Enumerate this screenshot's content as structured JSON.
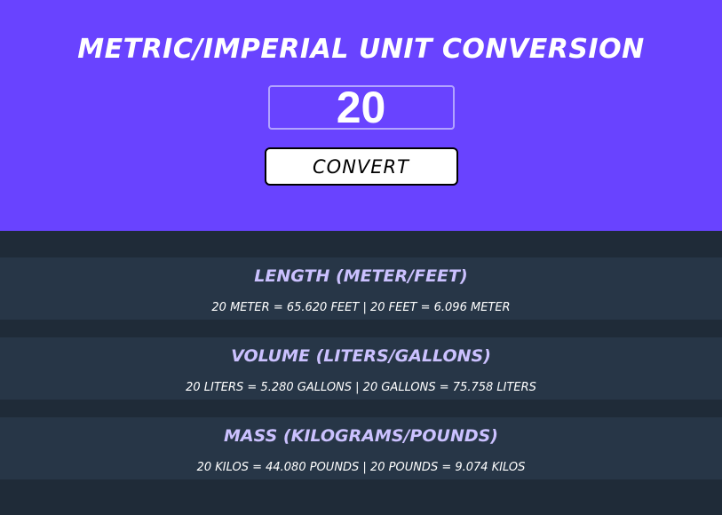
{
  "header": {
    "title": "METRIC/IMPERIAL UNIT CONVERSION"
  },
  "input": {
    "value": "20"
  },
  "convert_button": {
    "label": "CONVERT"
  },
  "conversions": [
    {
      "title": "LENGTH (METER/FEET)",
      "result": "20 METER = 65.620 FEET | 20 FEET = 6.096 METER"
    },
    {
      "title": "VOLUME (LITERS/GALLONS)",
      "result": "20 LITERS = 5.280 GALLONS | 20 GALLONS = 75.758 LITERS"
    },
    {
      "title": "MASS (KILOGRAMS/POUNDS)",
      "result": "20 KILOS = 44.080 POUNDS | 20 POUNDS = 9.074 KILOS"
    }
  ],
  "colors": {
    "hero_background": "#6943ff",
    "page_background": "#1f2b38",
    "card_background": "#273647",
    "card_title": "#cbc1ff",
    "input_border": "#b2a3ff"
  }
}
